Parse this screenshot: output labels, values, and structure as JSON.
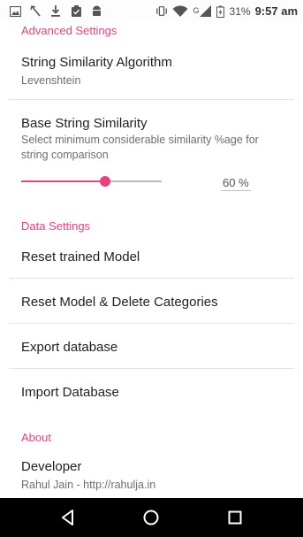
{
  "status_bar": {
    "network_label": "G",
    "battery_percent": "31%",
    "time": "9:57 am",
    "icons": [
      "gallery-icon",
      "missed-call-icon",
      "download-icon",
      "clipboard-icon",
      "android-icon",
      "vibrate-icon",
      "wifi-icon",
      "signal-icon",
      "battery-charging-icon"
    ]
  },
  "sections": {
    "advanced": {
      "header": "Advanced Settings",
      "algorithm": {
        "title": "String Similarity Algorithm",
        "summary": "Levenshtein"
      },
      "base_similarity": {
        "title": "Base String Similarity",
        "summary": "Select minimum considerable similarity %age for string comparison",
        "value_label": "60 %",
        "value_fraction": 0.6
      }
    },
    "data": {
      "header": "Data Settings",
      "reset_model": "Reset trained Model",
      "reset_delete": "Reset Model & Delete Categories",
      "export": "Export database",
      "import": "Import Database"
    },
    "about": {
      "header": "About",
      "developer": {
        "title": "Developer",
        "summary": "Rahul Jain - http://rahulja.in"
      }
    }
  },
  "colors": {
    "accent": "#e8407f",
    "nav_background": "#000000"
  }
}
